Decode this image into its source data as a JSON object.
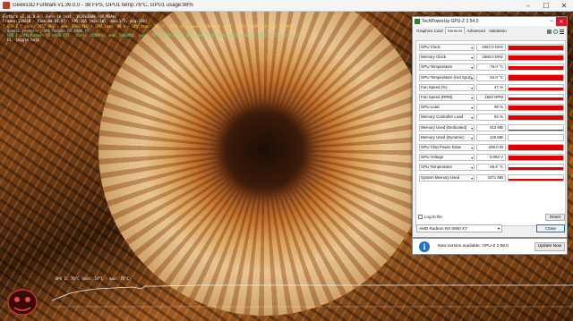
{
  "furmark": {
    "title": "Geeks3D FurMark v1.36.0.0 - 38 FPS, GPU1 temp:76°C, GPU1 usage:98%",
    "info_lines": [
      {
        "text": "FurMark v1.36.0.0 - Burn-in test, 1920x1080 (0X MSAA)",
        "color": "#ffffff"
      },
      {
        "text": "Frames:110818 - time:00:01:07 - FPS:165 (min:105, max:375, avg:166)",
        "color": "#ffffff"
      },
      {
        "text": "[ GPU-Z ] core: 2057 MHz - mem: 1960 MHz - GPU load: 98 % - GPU temp: 76 °C - GPU chip power: 288.0 W (PPW: 1.25) - GPU voltage: 0.993 V",
        "color": "#ffd24d"
      },
      {
        "text": "- OpenGL renderer: AMD Radeon RX 6900 XT",
        "color": "#8ad8ff"
      },
      {
        "text": "- GPU 1 (AMD Radeon RX 6900 XT) - core: 2058MHz, mem: 1960MHz, temp: 76°C, GPU load: 98%, mem load: 86%, power: 288 W (PPW: 1.25), fan: 47%",
        "color": "#7fe07f"
      },
      {
        "text": "- F1: toggle help",
        "color": "#ffffff"
      }
    ],
    "graph_label": "GPU 1: 76°C (min: 54°C - max: 76°C)"
  },
  "gpuz": {
    "title": "TechPowerUp GPU-Z 2.54.0",
    "tabs": [
      "Graphics Card",
      "Sensors",
      "Advanced",
      "Validation"
    ],
    "active_tab": "Sensors",
    "sensors": [
      {
        "label": "GPU Clock",
        "value": "2057.0 MHz",
        "level": 0.9
      },
      {
        "label": "Memory Clock",
        "value": "1960.0 MHz",
        "level": 0.85
      },
      {
        "label": "GPU Temperature",
        "value": "76.0 °C",
        "level": 0.8
      },
      {
        "label": "GPU Temperature (Hot Spot)",
        "value": "94.0 °C",
        "level": 0.9
      },
      {
        "label": "Fan Speed (%)",
        "value": "47 %",
        "level": 0.5
      },
      {
        "label": "Fan Speed (RPM)",
        "value": "1562 RPM",
        "level": 0.55
      },
      {
        "label": "GPU Load",
        "value": "98 %",
        "level": 0.95
      },
      {
        "label": "Memory Controller Load",
        "value": "84 %",
        "level": 0.85
      },
      {
        "label": "Memory Used (Dedicated)",
        "value": "413 MB",
        "level": 0.1
      },
      {
        "label": "Memory Used (Dynamic)",
        "value": "125 MB",
        "level": 0.05
      },
      {
        "label": "GPU Chip Power Draw",
        "value": "288.0 W",
        "level": 0.95
      },
      {
        "label": "GPU Voltage",
        "value": "0.993 V",
        "level": 0.8
      },
      {
        "label": "CPU Temperature",
        "value": "55.6 °C",
        "level": 0.55
      },
      {
        "label": "System Memory Used",
        "value": "4271 MB",
        "level": 0.3
      }
    ],
    "log_to_file": "Log to file",
    "reset": "Reset",
    "selected_gpu": "AMD Radeon RX 6900 XT",
    "close": "Close",
    "update_text": "New version available: GPU-Z 2.59.0",
    "update_button": "Update Now"
  },
  "colors": {
    "graph_red": "#e00000",
    "info_blue": "#1f6fd0"
  }
}
